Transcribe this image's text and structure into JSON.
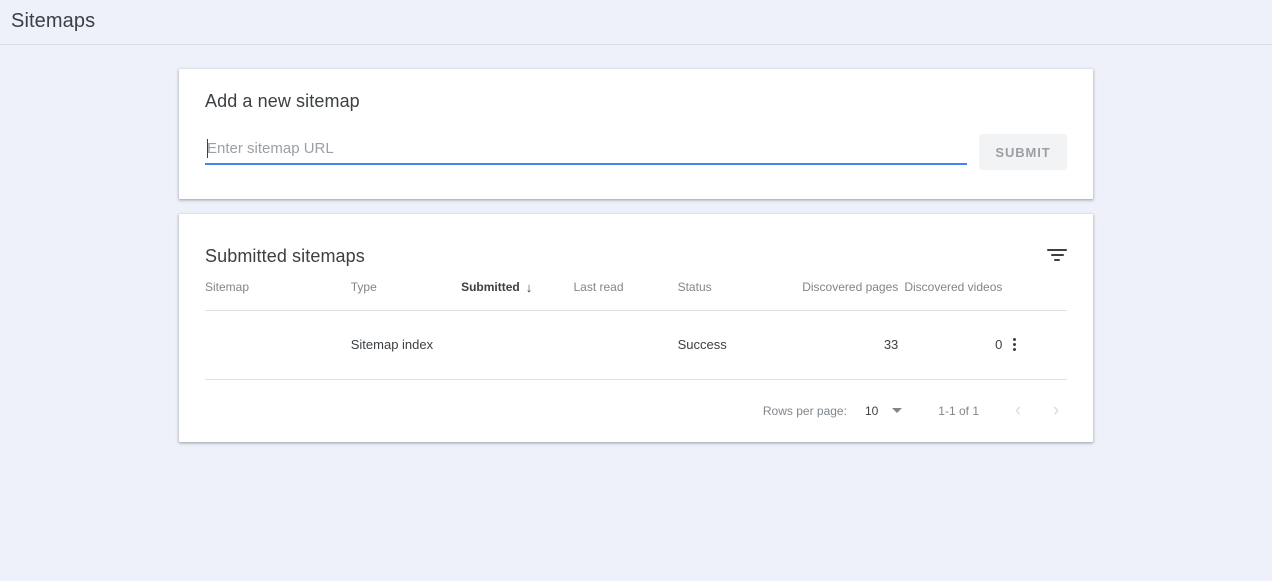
{
  "header": {
    "title": "Sitemaps"
  },
  "add_sitemap": {
    "title": "Add a new sitemap",
    "input_placeholder": "Enter sitemap URL",
    "input_value": "",
    "submit_label": "SUBMIT",
    "accent_color": "#4285f4",
    "submit_disabled_bg": "#f1f3f4",
    "submit_disabled_text": "#9aa0a6"
  },
  "submitted_sitemaps": {
    "title": "Submitted sitemaps",
    "filter_icon": "filter-list-icon",
    "columns": [
      {
        "label": "Sitemap",
        "align": "left",
        "sorted": false
      },
      {
        "label": "Type",
        "align": "left",
        "sorted": false
      },
      {
        "label": "Submitted",
        "align": "left",
        "sorted": true,
        "sort_direction": "desc",
        "sort_arrow": "↓"
      },
      {
        "label": "Last read",
        "align": "left",
        "sorted": false
      },
      {
        "label": "Status",
        "align": "left",
        "sorted": false
      },
      {
        "label": "Discovered pages",
        "align": "right",
        "sorted": false
      },
      {
        "label": "Discovered videos",
        "align": "right",
        "sorted": false
      }
    ],
    "rows": [
      {
        "sitemap": "",
        "type": "Sitemap index",
        "submitted": "",
        "last_read": "",
        "status": "Success",
        "status_color": "#188038",
        "discovered_pages": "33",
        "discovered_videos": "0",
        "row_menu_icon": "more-vert-icon"
      }
    ],
    "pagination": {
      "rows_per_page_label": "Rows per page:",
      "rows_per_page_value": "10",
      "range_label": "1-1 of 1",
      "prev_icon": "‹",
      "next_icon": "›",
      "prev_enabled": false,
      "next_enabled": false
    }
  },
  "theme": {
    "page_background": "#eef1fa",
    "card_background": "#ffffff",
    "text_primary": "#3c4043",
    "text_secondary": "#80868b",
    "divider": "#e0e0e0"
  }
}
